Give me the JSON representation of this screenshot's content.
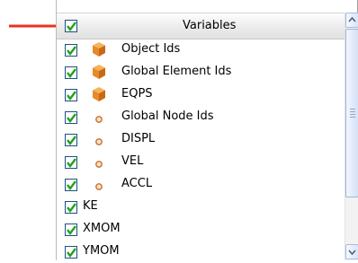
{
  "header": {
    "title": "Variables",
    "checked": true
  },
  "rows": [
    {
      "label": "Object Ids",
      "icon": "orange-cube-icon",
      "checked": true
    },
    {
      "label": "Global Element Ids",
      "icon": "orange-cube-icon",
      "checked": true
    },
    {
      "label": "EQPS",
      "icon": "orange-cube-icon",
      "checked": true
    },
    {
      "label": "Global Node Ids",
      "icon": "node-dot-icon",
      "checked": true
    },
    {
      "label": "DISPL",
      "icon": "node-dot-icon",
      "checked": true
    },
    {
      "label": "VEL",
      "icon": "node-dot-icon",
      "checked": true
    },
    {
      "label": "ACCL",
      "icon": "node-dot-icon",
      "checked": true
    },
    {
      "label": "KE",
      "icon": "",
      "checked": true
    },
    {
      "label": "XMOM",
      "icon": "",
      "checked": true
    },
    {
      "label": "YMOM",
      "icon": "",
      "checked": true
    }
  ],
  "colors": {
    "annotation_arrow": "#e8341c",
    "checkmark": "#21a121",
    "cube": "#e8892a",
    "node_dot": "#c8702a"
  }
}
